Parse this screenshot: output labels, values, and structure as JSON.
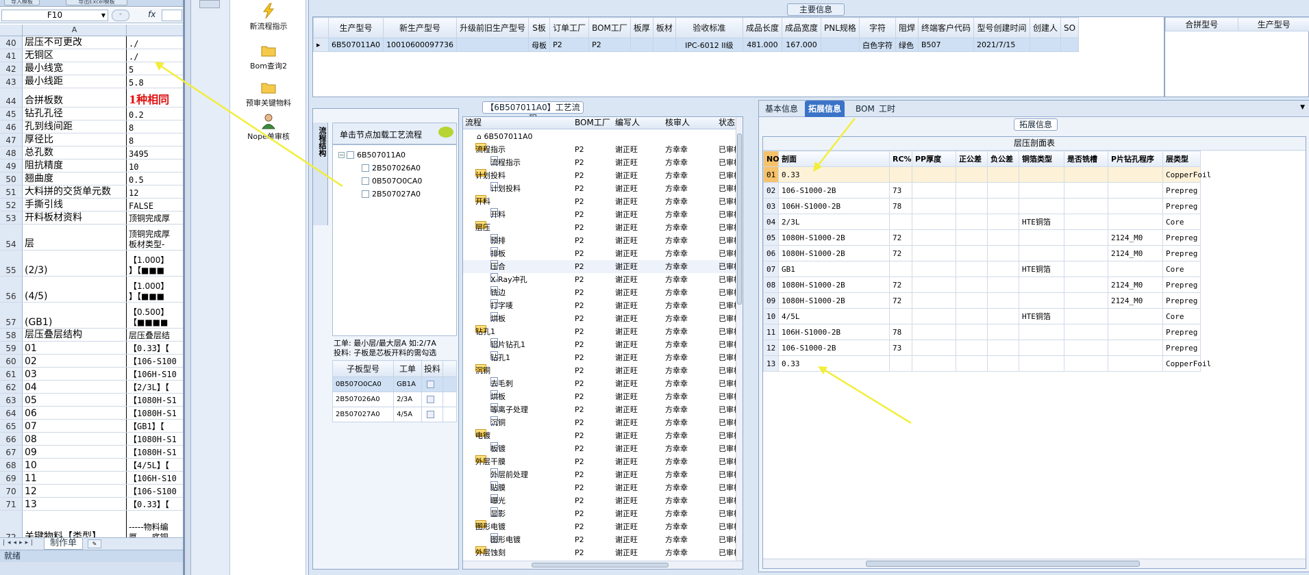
{
  "excel": {
    "top_buttons": [
      "导入模板",
      "导出Excel模板"
    ],
    "name_box": "F10",
    "fx": "fx",
    "col_a": "A",
    "rows": [
      {
        "n": "40",
        "a": "层压不可更改",
        "b": "./",
        "h": 19
      },
      {
        "n": "41",
        "a": "无铜区",
        "b": "./",
        "h": 19
      },
      {
        "n": "42",
        "a": "最小线宽",
        "b": "5",
        "h": 19
      },
      {
        "n": "43",
        "a": "最小线距",
        "b": "5.8",
        "h": 19
      },
      {
        "n": "44",
        "a": "合拼板数",
        "b": "1种相同",
        "h": 28,
        "red": true
      },
      {
        "n": "45",
        "a": "钻孔孔径",
        "b": "0.2",
        "h": 19
      },
      {
        "n": "46",
        "a": "孔到线间距",
        "b": "8",
        "h": 19
      },
      {
        "n": "47",
        "a": "厚径比",
        "b": "8",
        "h": 19
      },
      {
        "n": "48",
        "a": "总孔数",
        "b": "3495",
        "h": 19
      },
      {
        "n": "49",
        "a": "阻抗精度",
        "b": "10",
        "h": 19
      },
      {
        "n": "50",
        "a": "翘曲度",
        "b": "0.5",
        "h": 19
      },
      {
        "n": "51",
        "a": "大料拼的交货单元数",
        "b": "12",
        "h": 19
      },
      {
        "n": "52",
        "a": "手撕引线",
        "b": "FALSE",
        "h": 19
      },
      {
        "n": "53",
        "a": "开料板材资料",
        "b": "顶铜完成厚",
        "h": 19
      },
      {
        "n": "54",
        "a": "层",
        "b": "顶铜完成厚\n板材类型-",
        "h": 38,
        "ml": true
      },
      {
        "n": "55",
        "a": "(2/3)",
        "b": "【1.000】\n】【■■■",
        "h": 38,
        "ml": true
      },
      {
        "n": "56",
        "a": "(4/5)",
        "b": "【1.000】\n】【■■■",
        "h": 38,
        "ml": true
      },
      {
        "n": "57",
        "a": "(GB1)",
        "b": "【0.500】\n【■■■■",
        "h": 38,
        "ml": true
      },
      {
        "n": "58",
        "a": "层压叠层结构",
        "b": "层压叠层结",
        "h": 19
      },
      {
        "n": "59",
        "a": "01",
        "b": "【0.33】【",
        "h": 19
      },
      {
        "n": "60",
        "a": "02",
        "b": "【106-S100",
        "h": 19
      },
      {
        "n": "61",
        "a": "03",
        "b": "【106H-S10",
        "h": 19
      },
      {
        "n": "62",
        "a": "04",
        "b": "【2/3L】【",
        "h": 19
      },
      {
        "n": "63",
        "a": "05",
        "b": "【1080H-S1",
        "h": 19
      },
      {
        "n": "64",
        "a": "06",
        "b": "【1080H-S1",
        "h": 19
      },
      {
        "n": "65",
        "a": "07",
        "b": "【GB1】【",
        "h": 19
      },
      {
        "n": "66",
        "a": "08",
        "b": "【1080H-S1",
        "h": 19
      },
      {
        "n": "67",
        "a": "09",
        "b": "【1080H-S1",
        "h": 19
      },
      {
        "n": "68",
        "a": "10",
        "b": "【4/5L】【",
        "h": 19
      },
      {
        "n": "69",
        "a": "11",
        "b": "【106H-S10",
        "h": 19
      },
      {
        "n": "70",
        "a": "12",
        "b": "【106-S100",
        "h": 19
      },
      {
        "n": "71",
        "a": "13",
        "b": "【0.33】【",
        "h": 19
      },
      {
        "n": "72",
        "a": "关键物料【类型】",
        "b": "-----物料编\n厚-----底铜",
        "h": 48,
        "ml": true
      }
    ],
    "sheet_tab": "制作单",
    "status": "就绪"
  },
  "launcher": [
    {
      "label": "新流程指示",
      "icon": "lightning-icon"
    },
    {
      "label": "Bom查询2",
      "icon": "folder-icon"
    },
    {
      "label": "预审关键物料",
      "icon": "folder-icon"
    },
    {
      "label": "Nope单审核",
      "icon": "user-icon"
    }
  ],
  "main_info": {
    "title": "主要信息",
    "headers": [
      "生产型号",
      "新生产型号",
      "升级前旧生产型号",
      "S板",
      "订单工厂",
      "BOM工厂",
      "板厚",
      "板材",
      "验收标准",
      "成品长度",
      "成品宽度",
      "PNL规格",
      "字符",
      "阻焊",
      "终端客户代码",
      "型号创建时间",
      "创建人",
      "SO"
    ],
    "row": [
      "6B507011A0",
      "10010600097736",
      "",
      "母板",
      "P2",
      "P2",
      "",
      "",
      "IPC-6012 II级",
      "481.000",
      "167.000",
      "",
      "白色字符",
      "绿色",
      "B507",
      "2021/7/15",
      "",
      ""
    ],
    "side_headers": [
      "合拼型号",
      "生产型号"
    ]
  },
  "process": {
    "title": "【6B507011A0】工艺流程",
    "side_label": "流程结构",
    "hint": "单击节点加载工艺流程",
    "tree_root": "6B507011A0",
    "tree_children": [
      "2B507026A0",
      "0B507O0CA0",
      "2B507027A0"
    ],
    "notes": [
      "工单: 最小层/最大层A 如:2/7A",
      "投料: 子板是芯板开料的需勾选"
    ],
    "sub_headers": [
      "子板型号",
      "工单",
      "投料"
    ],
    "sub_rows": [
      {
        "model": "0B507O0CA0",
        "order": "GB1A"
      },
      {
        "model": "2B507026A0",
        "order": "2/3A"
      },
      {
        "model": "2B507027A0",
        "order": "4/5A"
      }
    ]
  },
  "flow": {
    "headers": [
      "流程",
      "BOM工厂",
      "编写人",
      "核审人",
      "状态"
    ],
    "root": "6B507011A0",
    "rows": [
      {
        "name": "流程指示",
        "lvl": 1,
        "folder": true
      },
      {
        "name": "流程指示",
        "lvl": 2
      },
      {
        "name": "计划投料",
        "lvl": 1,
        "folder": true
      },
      {
        "name": "计划投料",
        "lvl": 2
      },
      {
        "name": "开料",
        "lvl": 1,
        "folder": true
      },
      {
        "name": "开料",
        "lvl": 2
      },
      {
        "name": "层压",
        "lvl": 1,
        "folder": true
      },
      {
        "name": "预排",
        "lvl": 2
      },
      {
        "name": "排板",
        "lvl": 2
      },
      {
        "name": "压合",
        "lvl": 2,
        "sel": true
      },
      {
        "name": "X-Ray冲孔",
        "lvl": 2
      },
      {
        "name": "铣边",
        "lvl": 2
      },
      {
        "name": "打字唛",
        "lvl": 2
      },
      {
        "name": "烘板",
        "lvl": 2
      },
      {
        "name": "钻孔1",
        "lvl": 1,
        "folder": true
      },
      {
        "name": "铝片钻孔1",
        "lvl": 2
      },
      {
        "name": "钻孔1",
        "lvl": 2
      },
      {
        "name": "沉铜",
        "lvl": 1,
        "folder": true
      },
      {
        "name": "去毛刺",
        "lvl": 2
      },
      {
        "name": "烘板",
        "lvl": 2
      },
      {
        "name": "等离子处理",
        "lvl": 2
      },
      {
        "name": "沉铜",
        "lvl": 2
      },
      {
        "name": "电镀",
        "lvl": 1,
        "folder": true
      },
      {
        "name": "板镀",
        "lvl": 2
      },
      {
        "name": "外层干膜",
        "lvl": 1,
        "folder": true
      },
      {
        "name": "外层前处理",
        "lvl": 2
      },
      {
        "name": "贴膜",
        "lvl": 2
      },
      {
        "name": "曝光",
        "lvl": 2
      },
      {
        "name": "显影",
        "lvl": 2
      },
      {
        "name": "图形电镀",
        "lvl": 1,
        "folder": true
      },
      {
        "name": "图形电镀",
        "lvl": 2
      },
      {
        "name": "外层蚀刻",
        "lvl": 1,
        "folder": true
      }
    ],
    "factory": "P2",
    "writer": "谢正旺",
    "reviewer": "方幸幸",
    "status": "已审核"
  },
  "detail": {
    "tabs": [
      "基本信息",
      "拓展信息",
      "BOM",
      "工时"
    ],
    "active_tab": "拓展信息",
    "group_title": "拓展信息",
    "table_title": "层压剖面表",
    "headers": [
      "NO",
      "剖面",
      "RC%",
      "PP厚度",
      "正公差",
      "负公差",
      "铜箔类型",
      "是否铣槽",
      "P片钻孔程序",
      "层类型"
    ],
    "rows": [
      [
        "01",
        "0.33",
        "",
        "",
        "",
        "",
        "",
        "",
        "",
        "CopperFoil"
      ],
      [
        "02",
        "106-S1000-2B",
        "73",
        "",
        "",
        "",
        "",
        "",
        "",
        "Prepreg"
      ],
      [
        "03",
        "106H-S1000-2B",
        "78",
        "",
        "",
        "",
        "",
        "",
        "",
        "Prepreg"
      ],
      [
        "04",
        "2/3L",
        "",
        "",
        "",
        "",
        "HTE铜箔",
        "",
        "",
        "Core"
      ],
      [
        "05",
        "1080H-S1000-2B",
        "72",
        "",
        "",
        "",
        "",
        "",
        "2124_M0",
        "Prepreg"
      ],
      [
        "06",
        "1080H-S1000-2B",
        "72",
        "",
        "",
        "",
        "",
        "",
        "2124_M0",
        "Prepreg"
      ],
      [
        "07",
        "GB1",
        "",
        "",
        "",
        "",
        "HTE铜箔",
        "",
        "",
        "Core"
      ],
      [
        "08",
        "1080H-S1000-2B",
        "72",
        "",
        "",
        "",
        "",
        "",
        "2124_M0",
        "Prepreg"
      ],
      [
        "09",
        "1080H-S1000-2B",
        "72",
        "",
        "",
        "",
        "",
        "",
        "2124_M0",
        "Prepreg"
      ],
      [
        "10",
        "4/5L",
        "",
        "",
        "",
        "",
        "HTE铜箔",
        "",
        "",
        "Core"
      ],
      [
        "11",
        "106H-S1000-2B",
        "78",
        "",
        "",
        "",
        "",
        "",
        "",
        "Prepreg"
      ],
      [
        "12",
        "106-S1000-2B",
        "73",
        "",
        "",
        "",
        "",
        "",
        "",
        "Prepreg"
      ],
      [
        "13",
        "0.33",
        "",
        "",
        "",
        "",
        "",
        "",
        "",
        "CopperFoil"
      ]
    ]
  },
  "colors": {
    "annotation_arrow": "#f2ee3a",
    "accent": "#3a73c7",
    "sel_row": "#cfe0f4"
  }
}
